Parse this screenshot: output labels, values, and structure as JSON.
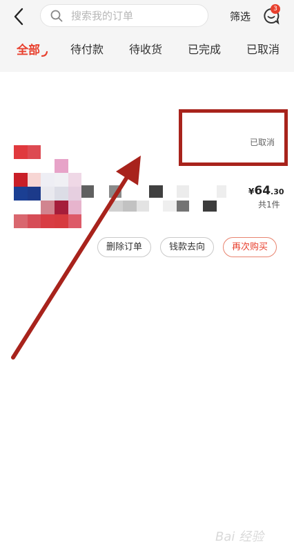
{
  "header": {
    "search_placeholder": "搜索我的订单",
    "filter_label": "筛选",
    "message_badge": "3",
    "icons": {
      "back": "chevron-left-icon",
      "search": "search-icon",
      "messages": "chat-bubble-icon"
    }
  },
  "tabs": [
    {
      "label": "全部",
      "active": true
    },
    {
      "label": "待付款",
      "active": false
    },
    {
      "label": "待收货",
      "active": false
    },
    {
      "label": "已完成",
      "active": false
    },
    {
      "label": "已取消",
      "active": false
    }
  ],
  "order": {
    "status": "已取消",
    "price_symbol": "¥",
    "price_int": "64",
    "price_dec": ".30",
    "count": "共1件",
    "buttons": {
      "delete": "删除订单",
      "refund": "钱款去向",
      "rebuy": "再次购买"
    }
  },
  "watermark": "Bai 经验",
  "colors": {
    "accent": "#e8402e",
    "annotation": "#a8231c"
  }
}
